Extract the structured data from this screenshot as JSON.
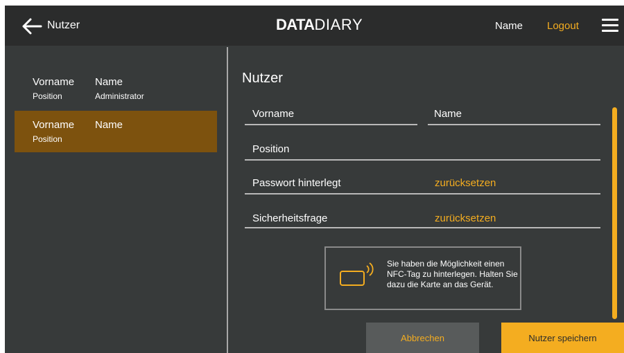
{
  "header": {
    "title": "Nutzer",
    "logo_bold": "DATA",
    "logo_thin": "DIARY",
    "user_name": "Name",
    "logout_label": "Logout",
    "back_icon": "arrow-left-icon",
    "menu_icon": "hamburger-menu-icon"
  },
  "sidebar": {
    "users": [
      {
        "first_name": "Vorname",
        "last_name": "Name",
        "position": "Position",
        "role": "Administrator",
        "selected": false
      },
      {
        "first_name": "Vorname",
        "last_name": "Name",
        "position": "Position",
        "role": "",
        "selected": true
      }
    ]
  },
  "form": {
    "title": "Nutzer",
    "first_name_label": "Vorname",
    "last_name_label": "Name",
    "position_label": "Position",
    "password_label": "Passwort hinterlegt",
    "password_reset": "zurücksetzen",
    "security_label": "Sicherheitsfrage",
    "security_reset": "zurücksetzen"
  },
  "nfc": {
    "icon": "nfc-card-icon",
    "text": "Sie haben die Möglichkeit einen NFC-Tag zu hinterlegen. Halten Sie dazu die Karte an das Gerät."
  },
  "buttons": {
    "cancel": "Abbrechen",
    "save": "Nutzer speichern"
  },
  "colors": {
    "accent": "#f4ad20",
    "selected_row": "#7d520e",
    "background": "#373a3a",
    "topbar": "#2b2c2c"
  }
}
